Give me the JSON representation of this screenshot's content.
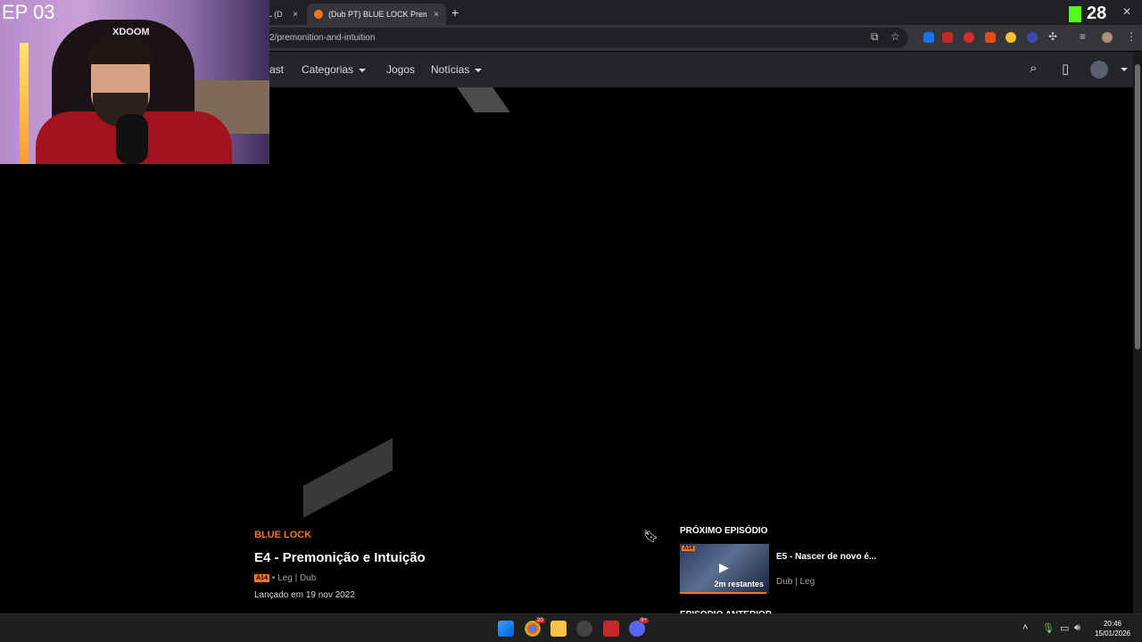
{
  "webcam": {
    "episode_label": "EP 03",
    "chair_brand": "XDOOM"
  },
  "tabs": [
    {
      "label": "L (D",
      "close": "×"
    },
    {
      "label": "(Dub PT) BLUE LOCK Premoniç",
      "close": "×"
    }
  ],
  "new_tab": "+",
  "kick_counter": "28",
  "window_close": "✕",
  "address": {
    "url": "2/premonition-and-intuition"
  },
  "nav": {
    "items": [
      {
        "label": "ast"
      },
      {
        "label": "Categorias",
        "dropdown": true
      },
      {
        "label": "Jogos"
      },
      {
        "label": "Notícias",
        "dropdown": true
      }
    ]
  },
  "episode": {
    "series": "BLUE LOCK",
    "title": "E4 - Premonição e Intuição",
    "rating_badge": "A14",
    "audio": "• Leg | Dub",
    "released": "Lançado em 19 nov 2022"
  },
  "next_episode": {
    "section_label": "PRÓXIMO EPISÓDIO",
    "thumb_badge": "A14",
    "remaining": "2m restantes",
    "progress": 0.97,
    "title": "E5 - Nascer de novo é...",
    "audio": "Dub | Leg"
  },
  "previous_episode": {
    "section_label": "EPISÓDIO ANTERIOR"
  },
  "taskbar": {
    "chrome_badge": "20",
    "discord_badge": "9+",
    "time": "20:46",
    "date": "15/01/2026"
  },
  "colors": {
    "accent": "#f47521",
    "kick_green": "#53fc18",
    "nav_bg": "#23252b"
  }
}
